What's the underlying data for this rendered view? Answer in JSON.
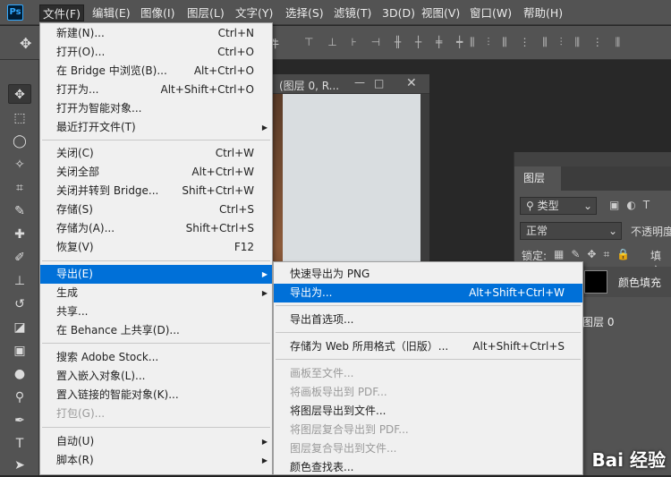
{
  "app": {
    "logo": "Ps"
  },
  "menubar": [
    {
      "label": "文件(F)",
      "active": true
    },
    {
      "label": "编辑(E)"
    },
    {
      "label": "图像(I)"
    },
    {
      "label": "图层(L)"
    },
    {
      "label": "文字(Y)"
    },
    {
      "label": "选择(S)"
    },
    {
      "label": "滤镜(T)"
    },
    {
      "label": "3D(D)"
    },
    {
      "label": "视图(V)"
    },
    {
      "label": "窗口(W)"
    },
    {
      "label": "帮助(H)"
    }
  ],
  "options_bar": {
    "partial_label": "件"
  },
  "document": {
    "title": "(图层 0, R..."
  },
  "layers_panel": {
    "tab": "图层",
    "filter": "类型",
    "blend_mode": "正常",
    "opacity_label": "不透明度",
    "lock_label": "锁定:",
    "fill_label": "填充",
    "layer1_name": "颜色填充",
    "layer2_name": "图层 0"
  },
  "file_menu": {
    "items": [
      {
        "label": "新建(N)...",
        "shortcut": "Ctrl+N"
      },
      {
        "label": "打开(O)...",
        "shortcut": "Ctrl+O"
      },
      {
        "label": "在 Bridge 中浏览(B)...",
        "shortcut": "Alt+Ctrl+O"
      },
      {
        "label": "打开为...",
        "shortcut": "Alt+Shift+Ctrl+O"
      },
      {
        "label": "打开为智能对象...",
        "shortcut": ""
      },
      {
        "label": "最近打开文件(T)",
        "shortcut": "",
        "submenu": true
      },
      {
        "label": "关闭(C)",
        "shortcut": "Ctrl+W"
      },
      {
        "label": "关闭全部",
        "shortcut": "Alt+Ctrl+W"
      },
      {
        "label": "关闭并转到 Bridge...",
        "shortcut": "Shift+Ctrl+W"
      },
      {
        "label": "存储(S)",
        "shortcut": "Ctrl+S"
      },
      {
        "label": "存储为(A)...",
        "shortcut": "Shift+Ctrl+S"
      },
      {
        "label": "恢复(V)",
        "shortcut": "F12"
      },
      {
        "label": "导出(E)",
        "shortcut": "",
        "submenu": true,
        "highlighted": true
      },
      {
        "label": "生成",
        "shortcut": "",
        "submenu": true
      },
      {
        "label": "共享...",
        "shortcut": ""
      },
      {
        "label": "在 Behance 上共享(D)...",
        "shortcut": ""
      },
      {
        "label": "搜索 Adobe Stock...",
        "shortcut": ""
      },
      {
        "label": "置入嵌入对象(L)...",
        "shortcut": ""
      },
      {
        "label": "置入链接的智能对象(K)...",
        "shortcut": ""
      },
      {
        "label": "打包(G)...",
        "shortcut": "",
        "disabled": true
      },
      {
        "label": "自动(U)",
        "shortcut": "",
        "submenu": true
      },
      {
        "label": "脚本(R)",
        "shortcut": "",
        "submenu": true
      }
    ]
  },
  "export_menu": {
    "items": [
      {
        "label": "快速导出为 PNG",
        "shortcut": ""
      },
      {
        "label": "导出为...",
        "shortcut": "Alt+Shift+Ctrl+W",
        "highlighted": true
      },
      {
        "label": "导出首选项...",
        "shortcut": ""
      },
      {
        "label": "存储为 Web 所用格式（旧版）...",
        "shortcut": "Alt+Shift+Ctrl+S"
      },
      {
        "label": "画板至文件...",
        "shortcut": "",
        "disabled": true
      },
      {
        "label": "将画板导出到 PDF...",
        "shortcut": "",
        "disabled": true
      },
      {
        "label": "将图层导出到文件...",
        "shortcut": ""
      },
      {
        "label": "将图层复合导出到 PDF...",
        "shortcut": "",
        "disabled": true
      },
      {
        "label": "图层复合导出到文件...",
        "shortcut": "",
        "disabled": true
      },
      {
        "label": "颜色查找表...",
        "shortcut": ""
      }
    ]
  },
  "watermark": {
    "text": "Bai 经验"
  }
}
